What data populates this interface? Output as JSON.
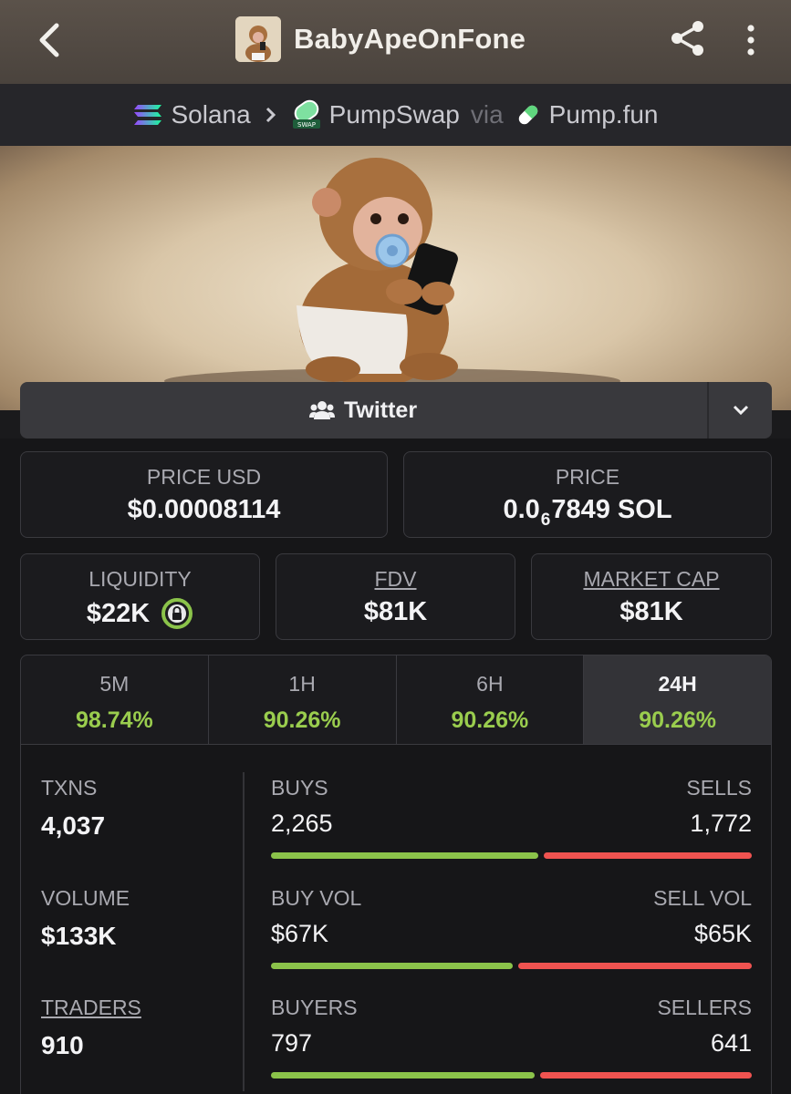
{
  "header": {
    "title": "BabyApeOnFone"
  },
  "breadcrumb": {
    "chain": "Solana",
    "dex": "PumpSwap",
    "via": "via",
    "launchpad": "Pump.fun"
  },
  "social": {
    "twitter_label": "Twitter"
  },
  "prices": {
    "price_usd_label": "PRICE USD",
    "price_usd_value": "$0.00008114",
    "price_label": "PRICE",
    "price_sol_prefix": "0.0",
    "price_sol_zeros": "6",
    "price_sol_rest": "7849 SOL"
  },
  "metrics": {
    "liquidity_label": "LIQUIDITY",
    "liquidity_value": "$22K",
    "fdv_label": "FDV",
    "fdv_value": "$81K",
    "mcap_label": "MARKET CAP",
    "mcap_value": "$81K"
  },
  "timeframes": [
    {
      "label": "5M",
      "change": "98.74%"
    },
    {
      "label": "1H",
      "change": "90.26%"
    },
    {
      "label": "6H",
      "change": "90.26%"
    },
    {
      "label": "24H",
      "change": "90.26%",
      "active": true
    }
  ],
  "stats": {
    "txns_label": "TXNS",
    "txns_value": "4,037",
    "volume_label": "VOLUME",
    "volume_value": "$133K",
    "traders_label": "TRADERS",
    "traders_value": "910",
    "buys_label": "BUYS",
    "buys_value": "2,265",
    "sells_label": "SELLS",
    "sells_value": "1,772",
    "buy_vol_label": "BUY VOL",
    "buy_vol_value": "$67K",
    "sell_vol_label": "SELL VOL",
    "sell_vol_value": "$65K",
    "buyers_label": "BUYERS",
    "buyers_value": "797",
    "sellers_label": "SELLERS",
    "sellers_value": "641",
    "buys_ratio": 0.561,
    "buy_vol_ratio": 0.508,
    "buyers_ratio": 0.554
  },
  "colors": {
    "positive": "#9acd4e",
    "buy_bar": "#8bc34a",
    "sell_bar": "#ef5350"
  }
}
